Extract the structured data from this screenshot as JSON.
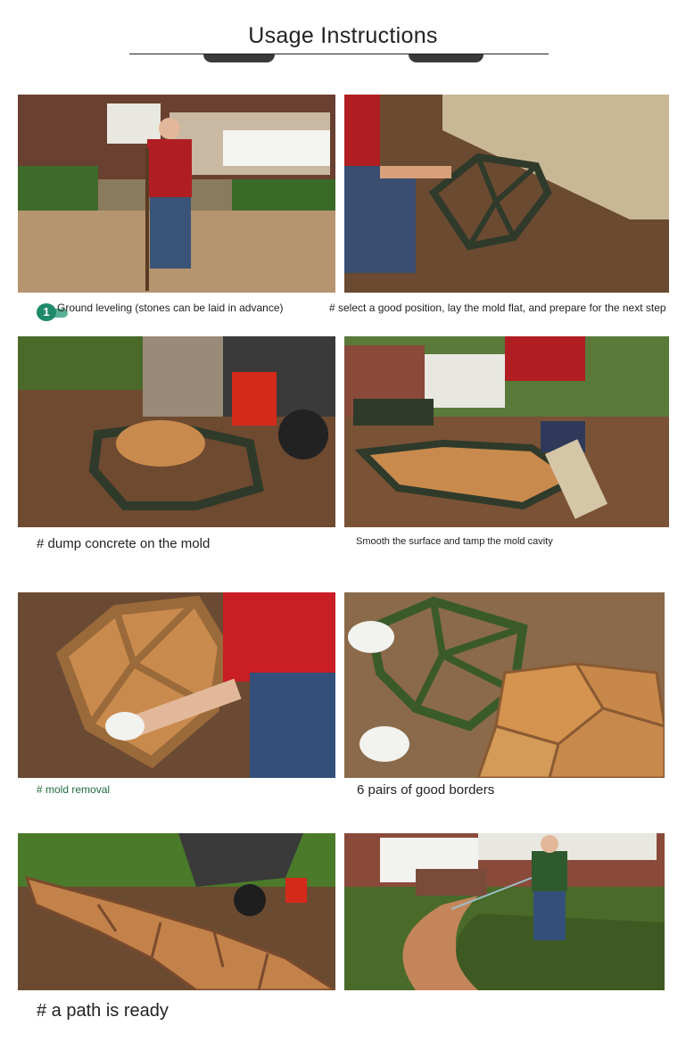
{
  "title": "Usage Instructions",
  "captions": {
    "step1": "Ground leveling (stones can be laid in advance)",
    "step1_badge": "1",
    "step2": "# select a good position, lay the mold flat, and prepare for the next step",
    "step3": "# dump concrete on the mold",
    "step4": "Smooth the surface and tamp the mold cavity",
    "step5": "# mold removal",
    "step6": "6 pairs of good borders",
    "step7": "# a path is ready"
  },
  "colors": {
    "soil": "#7a4a2c",
    "mold": "#2f3a2a",
    "shirt": "#b01e22",
    "concrete": "#c98a4e",
    "foliage": "#3e6a2a",
    "caption_green": "#1f6a3a"
  }
}
